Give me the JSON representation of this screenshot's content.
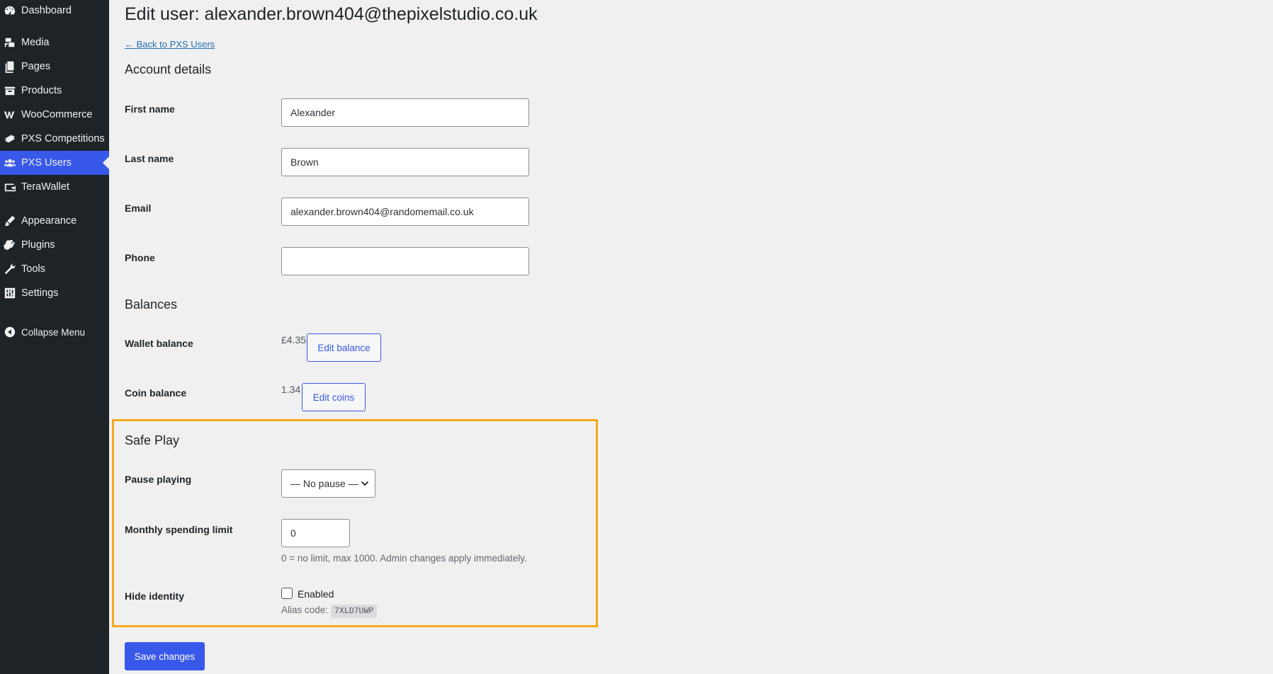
{
  "sidebar": {
    "items": [
      {
        "label": "Dashboard",
        "icon": "dashboard-icon"
      },
      {
        "label": "Media",
        "icon": "media-icon"
      },
      {
        "label": "Pages",
        "icon": "pages-icon"
      },
      {
        "label": "Products",
        "icon": "products-icon"
      },
      {
        "label": "WooCommerce",
        "icon": "woocommerce-icon"
      },
      {
        "label": "PXS Competitions",
        "icon": "competitions-icon"
      },
      {
        "label": "PXS Users",
        "icon": "users-icon",
        "active": true
      },
      {
        "label": "TeraWallet",
        "icon": "wallet-icon"
      },
      {
        "label": "Appearance",
        "icon": "appearance-icon"
      },
      {
        "label": "Plugins",
        "icon": "plugins-icon"
      },
      {
        "label": "Tools",
        "icon": "tools-icon"
      },
      {
        "label": "Settings",
        "icon": "settings-icon"
      },
      {
        "label": "Collapse Menu",
        "icon": "collapse-icon"
      }
    ]
  },
  "page": {
    "title": "Edit user: alexander.brown404@thepixelstudio.co.uk",
    "back_link": "← Back to PXS Users"
  },
  "account": {
    "heading": "Account details",
    "first_name_label": "First name",
    "first_name_value": "Alexander",
    "last_name_label": "Last name",
    "last_name_value": "Brown",
    "email_label": "Email",
    "email_value": "alexander.brown404@randomemail.co.uk",
    "phone_label": "Phone",
    "phone_value": ""
  },
  "balances": {
    "heading": "Balances",
    "wallet_label": "Wallet balance",
    "wallet_value": "£4.35",
    "wallet_button": "Edit balance",
    "coin_label": "Coin balance",
    "coin_value": "1.34",
    "coin_button": "Edit coins"
  },
  "safe_play": {
    "heading": "Safe Play",
    "pause_label": "Pause playing",
    "pause_selected": "— No pause —",
    "limit_label": "Monthly spending limit",
    "limit_value": "0",
    "limit_help": "0 = no limit, max 1000. Admin changes apply immediately.",
    "hide_label": "Hide identity",
    "hide_checkbox_label": "Enabled",
    "hide_checked": false,
    "alias_label": "Alias code:",
    "alias_code": "7XLD7UWP",
    "highlight_color": "#f5a81c"
  },
  "actions": {
    "save_label": "Save changes"
  },
  "colors": {
    "accent": "#3858e9",
    "sidebar_bg": "#1d2327",
    "page_bg": "#f0f0f1"
  }
}
